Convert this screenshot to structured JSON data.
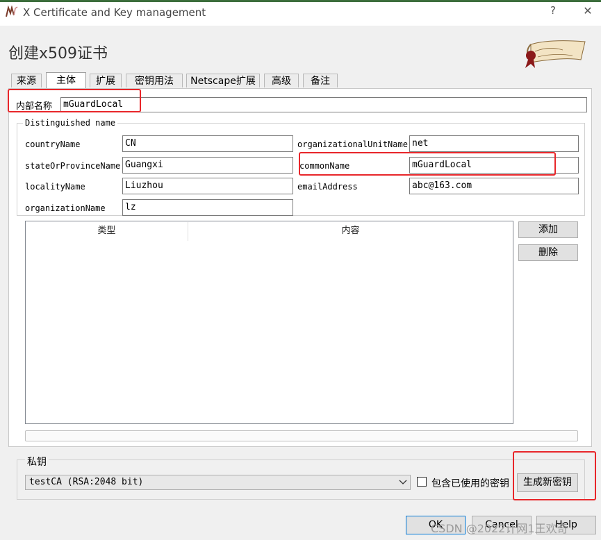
{
  "window": {
    "title": "X Certificate and Key management",
    "help": "?",
    "close": "✕"
  },
  "page_title": "创建x509证书",
  "tabs": [
    {
      "label": "来源"
    },
    {
      "label": "主体"
    },
    {
      "label": "扩展"
    },
    {
      "label": "密钥用法"
    },
    {
      "label": "Netscape扩展"
    },
    {
      "label": "高级"
    },
    {
      "label": "备注"
    }
  ],
  "internal_name": {
    "label": "内部名称",
    "value": "mGuardLocal"
  },
  "dn": {
    "group_title": "Distinguished name",
    "countryName": {
      "label": "countryName",
      "value": "CN"
    },
    "stateOrProvinceName": {
      "label": "stateOrProvinceName",
      "value": "Guangxi"
    },
    "localityName": {
      "label": "localityName",
      "value": "Liuzhou"
    },
    "organizationName": {
      "label": "organizationName",
      "value": "lz"
    },
    "organizationalUnitName": {
      "label": "organizationalUnitName",
      "value": "net"
    },
    "commonName": {
      "label": "commonName",
      "value": "mGuardLocal"
    },
    "emailAddress": {
      "label": "emailAddress",
      "value": "abc@163.com"
    }
  },
  "table": {
    "columns": [
      "类型",
      "内容"
    ]
  },
  "buttons": {
    "add": "添加",
    "delete": "删除",
    "generate_key": "生成新密钥",
    "ok": "OK",
    "cancel": "Cancel",
    "help": "Help"
  },
  "private_key": {
    "group_title": "私钥",
    "selected": "testCA (RSA:2048 bit)",
    "checkbox_label": "包含已使用的密钥"
  },
  "watermark": "CSDN @2022计网1王欢奇",
  "colors": {
    "highlight": "#e8262a",
    "background": "#f0f0f0"
  }
}
